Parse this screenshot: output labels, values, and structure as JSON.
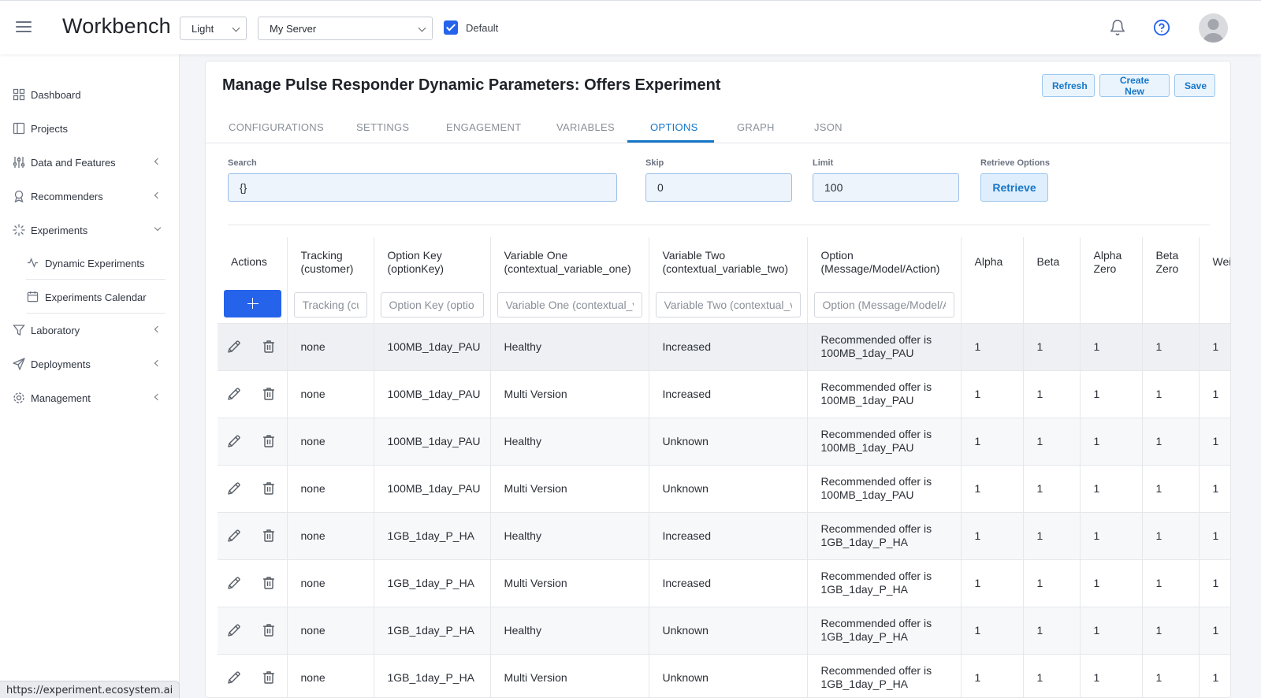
{
  "topbar": {
    "brand": "Workbench",
    "theme_select": "Light",
    "server_select": "My Server",
    "default_label": "Default"
  },
  "sidebar": {
    "items": [
      {
        "label": "Dashboard",
        "icon": "dashboard-icon"
      },
      {
        "label": "Projects",
        "icon": "projects-icon"
      },
      {
        "label": "Data and Features",
        "icon": "sliders-icon"
      },
      {
        "label": "Recommenders",
        "icon": "award-icon"
      },
      {
        "label": "Experiments",
        "icon": "loader-icon"
      },
      {
        "label": "Laboratory",
        "icon": "filter-icon"
      },
      {
        "label": "Deployments",
        "icon": "send-icon"
      },
      {
        "label": "Management",
        "icon": "gear-icon"
      }
    ],
    "sub_items": [
      {
        "label": "Dynamic Experiments",
        "icon": "activity-icon"
      },
      {
        "label": "Experiments Calendar",
        "icon": "calendar-icon"
      }
    ]
  },
  "status_url": "https://experiment.ecosystem.ai",
  "page": {
    "title": "Manage Pulse Responder Dynamic Parameters: Offers Experiment",
    "buttons": {
      "refresh": "Refresh",
      "create": "Create New",
      "save": "Save"
    },
    "tabs": [
      "CONFIGURATIONS",
      "SETTINGS",
      "ENGAGEMENT",
      "VARIABLES",
      "OPTIONS",
      "GRAPH",
      "JSON"
    ],
    "active_tab": "OPTIONS",
    "form": {
      "search_label": "Search",
      "search_value": "{}",
      "skip_label": "Skip",
      "skip_value": "0",
      "limit_label": "Limit",
      "limit_value": "100",
      "retrieve_label": "Retrieve Options",
      "retrieve_button": "Retrieve"
    }
  },
  "table": {
    "headers": {
      "actions": "Actions",
      "tracking": [
        "Tracking",
        "(customer)"
      ],
      "option_key": [
        "Option Key",
        "(optionKey)"
      ],
      "var_one": [
        "Variable One",
        "(contextual_variable_one)"
      ],
      "var_two": [
        "Variable Two",
        "(contextual_variable_two)"
      ],
      "option": [
        "Option",
        "(Message/Model/Action)"
      ],
      "alpha": "Alpha",
      "beta": "Beta",
      "alpha_zero": [
        "Alpha",
        "Zero"
      ],
      "beta_zero": [
        "Beta",
        "Zero"
      ],
      "weight": "Wei"
    },
    "placeholders": {
      "tracking": "Tracking (cu",
      "option_key": "Option Key (optio",
      "var_one": "Variable One (contextual_v",
      "var_two": "Variable Two (contextual_v",
      "option": "Option (Message/Model/A"
    },
    "rows": [
      {
        "tracking": "none",
        "option_key": "100MB_1day_PAU",
        "var_one": "Healthy",
        "var_two": "Increased",
        "option": [
          "Recommended offer is",
          "100MB_1day_PAU"
        ],
        "alpha": "1",
        "beta": "1",
        "alpha_zero": "1",
        "beta_zero": "1",
        "weight": "1"
      },
      {
        "tracking": "none",
        "option_key": "100MB_1day_PAU",
        "var_one": "Multi Version",
        "var_two": "Increased",
        "option": [
          "Recommended offer is",
          "100MB_1day_PAU"
        ],
        "alpha": "1",
        "beta": "1",
        "alpha_zero": "1",
        "beta_zero": "1",
        "weight": "1"
      },
      {
        "tracking": "none",
        "option_key": "100MB_1day_PAU",
        "var_one": "Healthy",
        "var_two": "Unknown",
        "option": [
          "Recommended offer is",
          "100MB_1day_PAU"
        ],
        "alpha": "1",
        "beta": "1",
        "alpha_zero": "1",
        "beta_zero": "1",
        "weight": "1"
      },
      {
        "tracking": "none",
        "option_key": "100MB_1day_PAU",
        "var_one": "Multi Version",
        "var_two": "Unknown",
        "option": [
          "Recommended offer is",
          "100MB_1day_PAU"
        ],
        "alpha": "1",
        "beta": "1",
        "alpha_zero": "1",
        "beta_zero": "1",
        "weight": "1"
      },
      {
        "tracking": "none",
        "option_key": "1GB_1day_P_HA",
        "var_one": "Healthy",
        "var_two": "Increased",
        "option": [
          "Recommended offer is",
          "1GB_1day_P_HA"
        ],
        "alpha": "1",
        "beta": "1",
        "alpha_zero": "1",
        "beta_zero": "1",
        "weight": "1"
      },
      {
        "tracking": "none",
        "option_key": "1GB_1day_P_HA",
        "var_one": "Multi Version",
        "var_two": "Increased",
        "option": [
          "Recommended offer is",
          "1GB_1day_P_HA"
        ],
        "alpha": "1",
        "beta": "1",
        "alpha_zero": "1",
        "beta_zero": "1",
        "weight": "1"
      },
      {
        "tracking": "none",
        "option_key": "1GB_1day_P_HA",
        "var_one": "Healthy",
        "var_two": "Unknown",
        "option": [
          "Recommended offer is",
          "1GB_1day_P_HA"
        ],
        "alpha": "1",
        "beta": "1",
        "alpha_zero": "1",
        "beta_zero": "1",
        "weight": "1"
      },
      {
        "tracking": "none",
        "option_key": "1GB_1day_P_HA",
        "var_one": "Multi Version",
        "var_two": "Unknown",
        "option": [
          "Recommended offer is",
          "1GB_1day_P_HA"
        ],
        "alpha": "1",
        "beta": "1",
        "alpha_zero": "1",
        "beta_zero": "1",
        "weight": "1"
      }
    ]
  },
  "colors": {
    "primary": "#2563eb",
    "accent": "#1677c8"
  }
}
